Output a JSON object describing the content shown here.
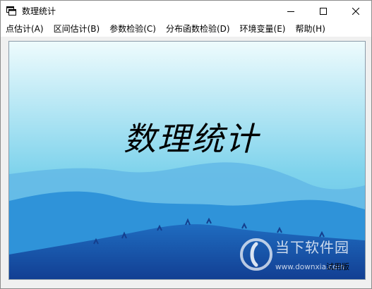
{
  "window": {
    "title": "数理统计",
    "app_icon": "app-window-icon",
    "controls": {
      "minimize_icon": "minimize-icon",
      "maximize_icon": "maximize-icon",
      "close_icon": "close-icon"
    }
  },
  "menu": {
    "items": [
      {
        "label": "点估计(A)"
      },
      {
        "label": "区间估计(B)"
      },
      {
        "label": "参数检验(C)"
      },
      {
        "label": "分布函数检验(D)"
      },
      {
        "label": "环境变量(E)"
      },
      {
        "label": "帮助(H)"
      }
    ]
  },
  "splash": {
    "title": "数理统计",
    "trial_label": "试用版",
    "colors": {
      "sky_top": "#eefbfd",
      "sky_mid": "#7fd3ec",
      "mountain_far": "#63b8e6",
      "mountain_mid": "#2f93d9",
      "mountain_near": "#1a5cb4"
    }
  },
  "watermark": {
    "logo_icon": "downxia-logo-icon",
    "name": "当下软件园",
    "url": "www.downxia.com"
  }
}
